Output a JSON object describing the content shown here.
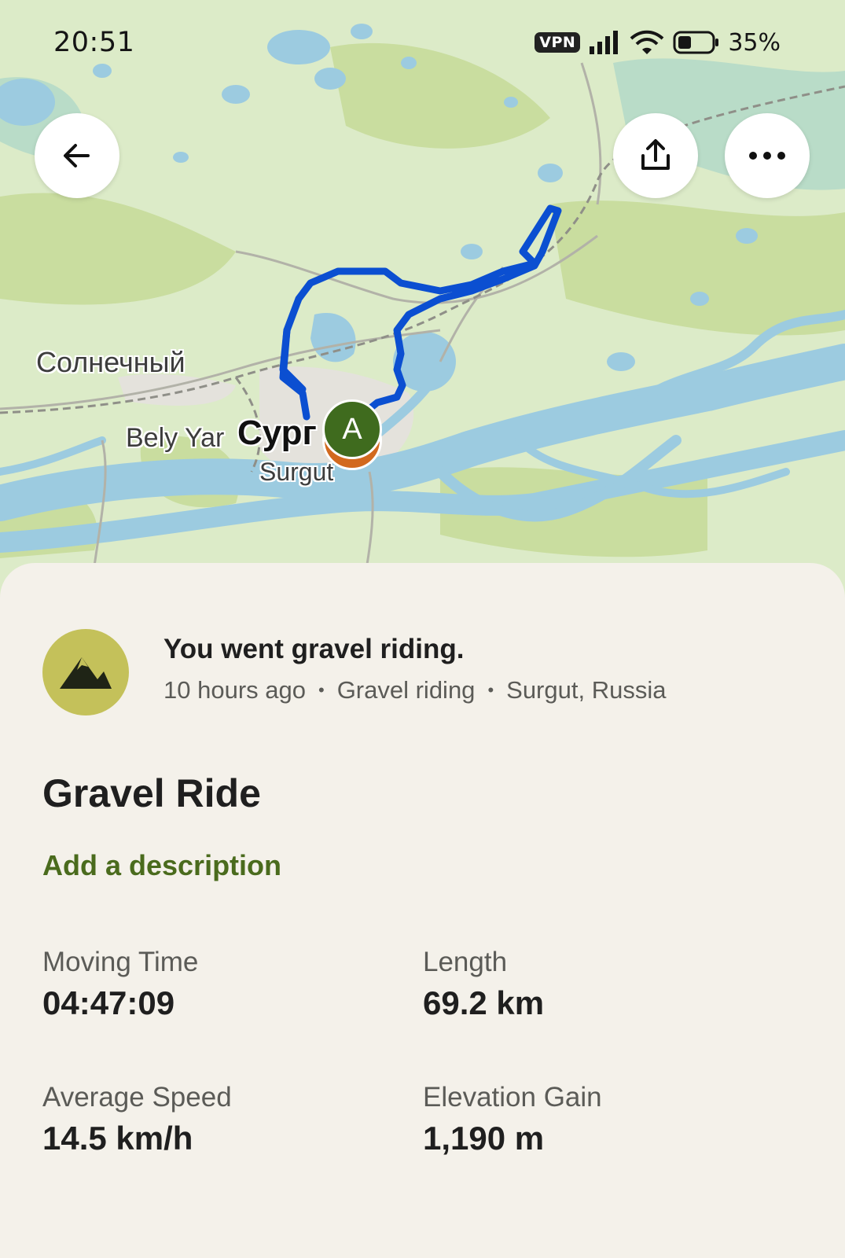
{
  "status_bar": {
    "time": "20:51",
    "vpn_label": "VPN",
    "battery_percent": "35%"
  },
  "map": {
    "labels": {
      "solnechny": "Солнечный",
      "bely_yar": "Bely Yar",
      "city_local": "Сург",
      "city_en": "Surgut"
    },
    "start_marker_label": "A",
    "route_color": "#0b4fd1",
    "marker_color": "#3f6b1e",
    "end_marker_color": "#d2691e"
  },
  "toolbar": {
    "back_icon": "arrow-left-icon",
    "share_icon": "share-icon",
    "more_icon": "more-horizontal-icon"
  },
  "activity": {
    "icon": "mountain-icon",
    "headline": "You went gravel riding.",
    "time_ago": "10 hours ago",
    "type": "Gravel riding",
    "location": "Surgut, Russia",
    "title": "Gravel Ride",
    "add_description": "Add a description"
  },
  "stats": {
    "moving_time": {
      "label": "Moving Time",
      "value": "04:47:09"
    },
    "length": {
      "label": "Length",
      "value": "69.2 km"
    },
    "average_speed": {
      "label": "Average Speed",
      "value": "14.5 km/h"
    },
    "elevation_gain": {
      "label": "Elevation Gain",
      "value": "1,190 m"
    }
  },
  "colors": {
    "accent_green": "#4a6b1d",
    "sheet_bg": "#f4f1ea",
    "activity_icon_bg": "#c4c15a"
  }
}
